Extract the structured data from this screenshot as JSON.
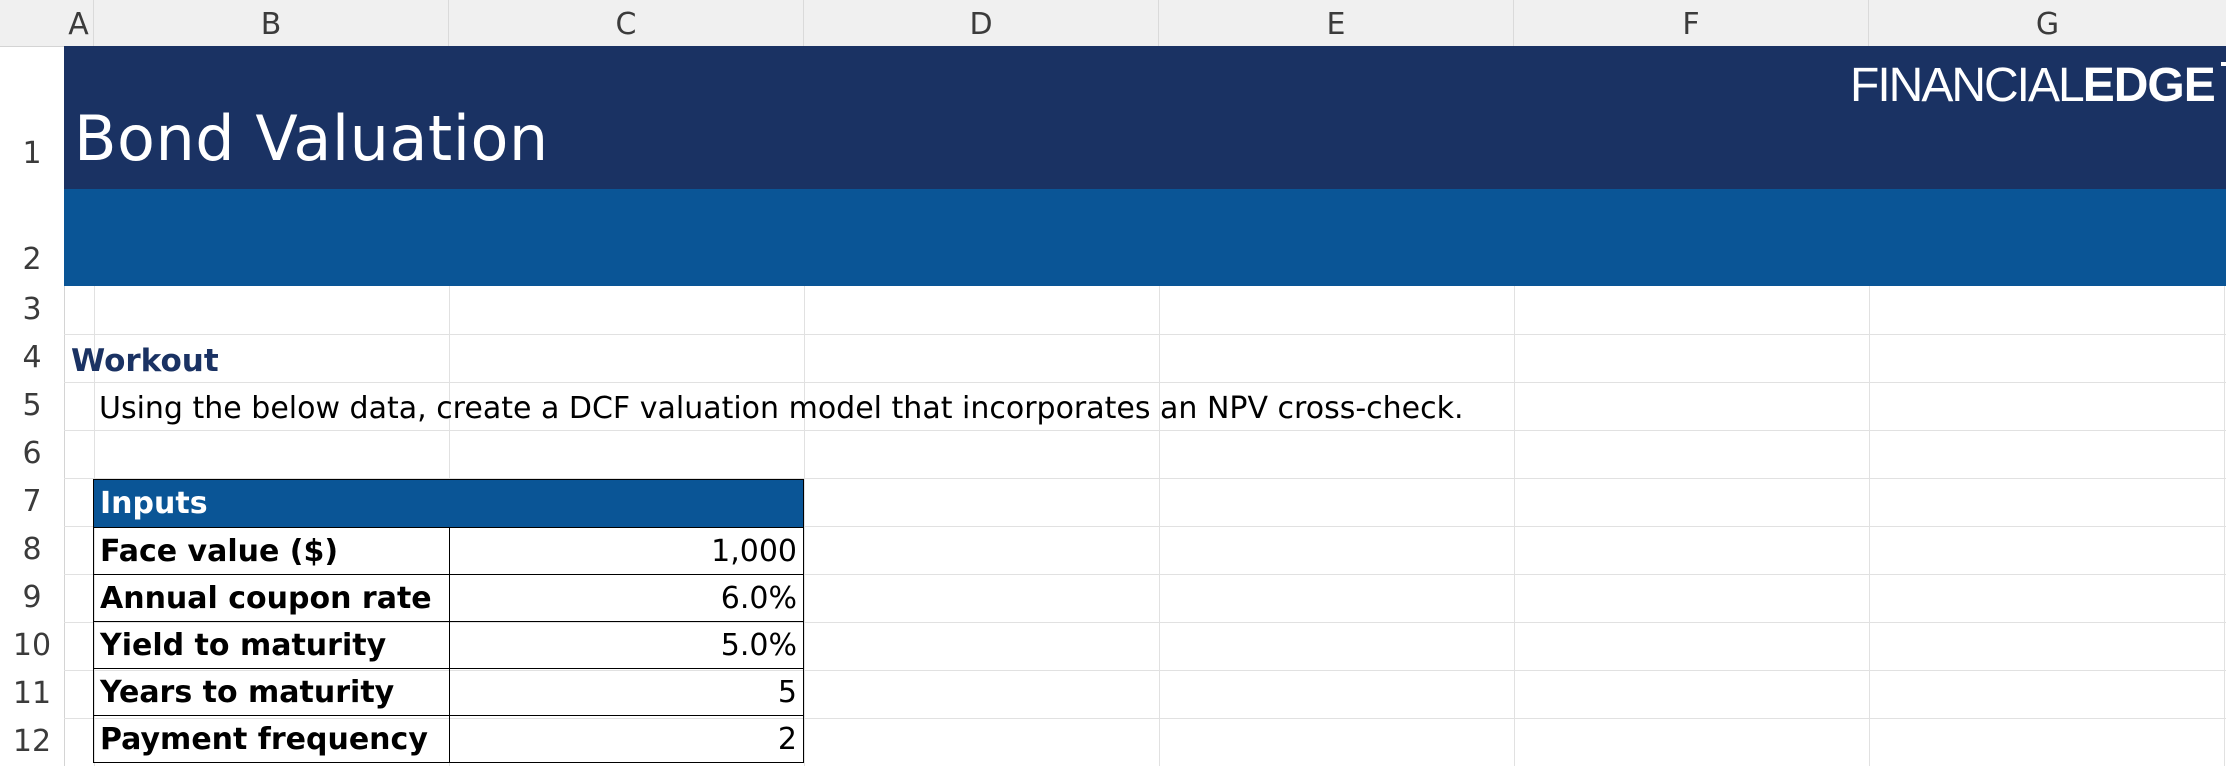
{
  "columns": [
    "A",
    "B",
    "C",
    "D",
    "E",
    "F",
    "G"
  ],
  "rows": [
    "1",
    "2",
    "3",
    "4",
    "5",
    "6",
    "7",
    "8",
    "9",
    "10",
    "11",
    "12"
  ],
  "sheet": {
    "title": "Bond Valuation",
    "logo_regular": "FINANCIAL",
    "logo_bold": "EDGE",
    "section_heading": "Workout",
    "instruction": "Using the below data, create a DCF valuation model that incorporates an NPV cross-check."
  },
  "inputs": {
    "header": "Inputs",
    "items": [
      {
        "label": "Face value ($)",
        "value": "1,000"
      },
      {
        "label": "Annual coupon rate",
        "value": "6.0%"
      },
      {
        "label": "Yield to maturity",
        "value": "5.0%"
      },
      {
        "label": "Years to maturity",
        "value": "5"
      },
      {
        "label": "Payment frequency",
        "value": "2"
      }
    ]
  },
  "colors": {
    "banner_dark": "#1a3263",
    "banner_blue": "#0a5596",
    "heading": "#1a3263"
  }
}
